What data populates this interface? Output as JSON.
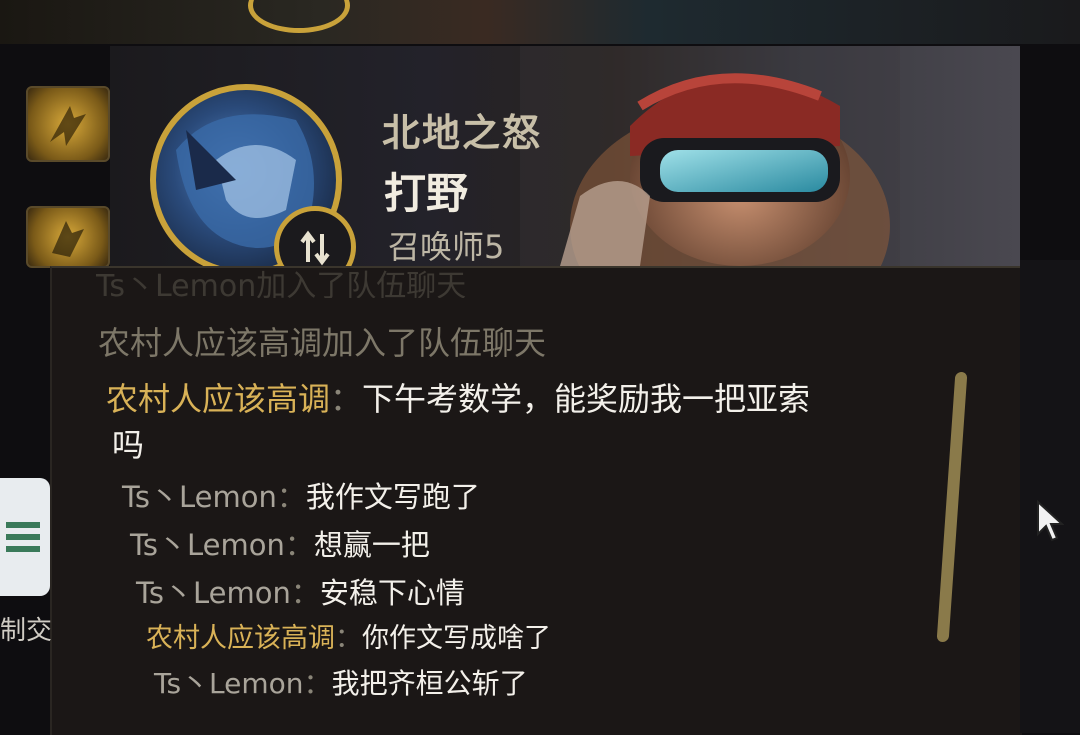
{
  "player": {
    "champion_title": "北地之怒",
    "role": "打野",
    "summoner": "召唤师5",
    "badge_icon": "role-swap-icon"
  },
  "chat": {
    "ghost_line": "Ts丶Lemon加入了队伍聊天",
    "system_line": "农村人应该高调加入了队伍聊天",
    "messages": [
      {
        "sender": "农村人应该高调",
        "colon": "：",
        "text": "下午考数学，能奖励我一把亚索",
        "text_cont": "吗"
      },
      {
        "sender": "Ts丶Lemon",
        "colon": "：",
        "text": "我作文写跑了"
      },
      {
        "sender": "Ts丶Lemon",
        "colon": "：",
        "text": "想赢一把"
      },
      {
        "sender": "Ts丶Lemon",
        "colon": "：",
        "text": "安稳下心情"
      },
      {
        "sender": "农村人应该高调",
        "colon": "：",
        "text": "你作文写成啥了"
      },
      {
        "sender": "Ts丶Lemon",
        "colon": "：",
        "text": "我把齐桓公斩了"
      }
    ]
  },
  "side": {
    "label": "制交"
  },
  "colors": {
    "gold": "#c9a23a",
    "sender_gold": "#d9b257",
    "sender_grey": "#a9a49a",
    "message_text": "#f3f0ea",
    "panel_bg": "#1b1716"
  }
}
